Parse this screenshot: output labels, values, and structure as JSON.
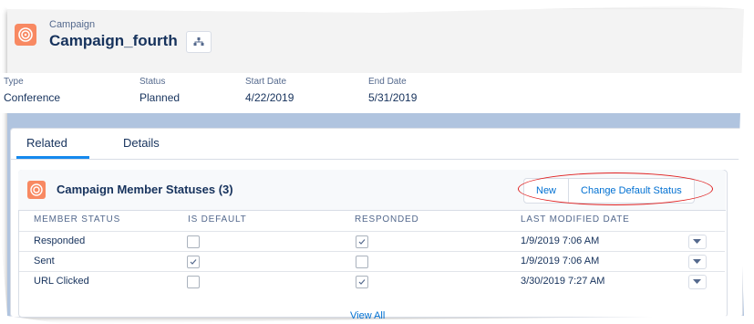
{
  "header": {
    "object_label": "Campaign",
    "record_title": "Campaign_fourth",
    "icon": "campaign-target-icon",
    "hierarchy_icon": "hierarchy-icon"
  },
  "fields": [
    {
      "label": "Type",
      "value": "Conference"
    },
    {
      "label": "Status",
      "value": "Planned"
    },
    {
      "label": "Start Date",
      "value": "4/22/2019"
    },
    {
      "label": "End Date",
      "value": "5/31/2019"
    }
  ],
  "tabs": [
    {
      "label": "Related",
      "active": true
    },
    {
      "label": "Details",
      "active": false
    }
  ],
  "related_list": {
    "title": "Campaign Member Statuses (3)",
    "buttons": {
      "new": "New",
      "change_default": "Change Default Status"
    },
    "columns": [
      "MEMBER STATUS",
      "IS DEFAULT",
      "RESPONDED",
      "LAST MODIFIED DATE"
    ],
    "rows": [
      {
        "status": "Responded",
        "is_default": false,
        "responded": true,
        "modified": "1/9/2019 7:06 AM"
      },
      {
        "status": "Sent",
        "is_default": true,
        "responded": false,
        "modified": "1/9/2019 7:06 AM"
      },
      {
        "status": "URL Clicked",
        "is_default": false,
        "responded": true,
        "modified": "3/30/2019 7:27 AM"
      }
    ],
    "view_all": "View All"
  },
  "colors": {
    "brand_orange": "#f88962",
    "link_blue": "#0070d2",
    "annotation_red": "#e02020",
    "background_band": "#b0c4df"
  }
}
